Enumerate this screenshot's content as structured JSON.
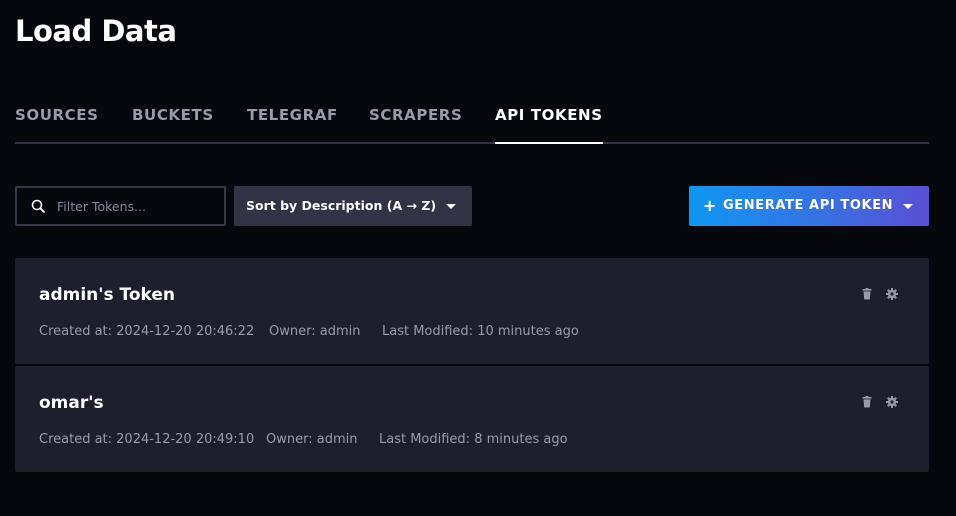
{
  "page": {
    "title": "Load Data"
  },
  "tabs": [
    {
      "label": "SOURCES",
      "active": false
    },
    {
      "label": "BUCKETS",
      "active": false
    },
    {
      "label": "TELEGRAF",
      "active": false
    },
    {
      "label": "SCRAPERS",
      "active": false
    },
    {
      "label": "API TOKENS",
      "active": true
    }
  ],
  "toolbar": {
    "filter_placeholder": "Filter Tokens...",
    "filter_value": "",
    "sort_label": "Sort by Description (A → Z)",
    "generate_label": "GENERATE API TOKEN",
    "generate_prefix": "+"
  },
  "tokens": [
    {
      "name": "admin's Token",
      "created": "Created at: 2024-12-20 20:46:22",
      "owner": "Owner: admin",
      "modified": "Last Modified: 10 minutes ago"
    },
    {
      "name": "omar's",
      "created": "Created at: 2024-12-20 20:49:10",
      "owner": "Owner: admin",
      "modified": "Last Modified: 8 minutes ago"
    }
  ],
  "icons": {
    "search": "search-icon",
    "delete": "trash-icon",
    "settings": "gear-icon",
    "dropdown": "chevron-down-icon"
  },
  "colors": {
    "background": "#07070e",
    "card": "#1e1e2c",
    "dropdown": "#333346",
    "accent_start": "#0f97f2",
    "accent_end": "#5b4fd4",
    "muted_text": "#9a9aaa"
  }
}
